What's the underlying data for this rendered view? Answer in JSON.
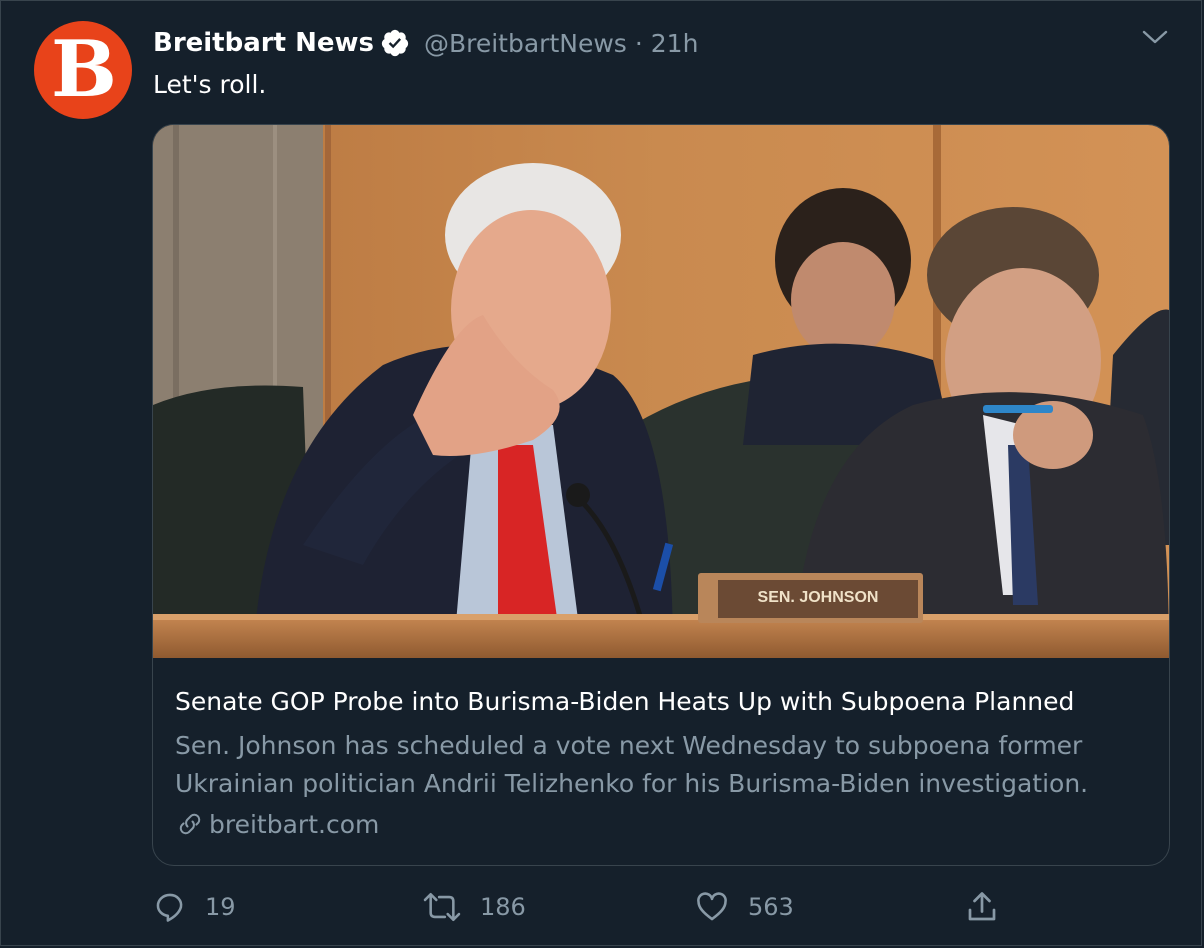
{
  "tweet": {
    "author_name": "Breitbart News",
    "handle": "@BreitbartNews",
    "separator": "·",
    "time": "21h",
    "text": "Let's roll.",
    "avatar_letter": "B"
  },
  "card": {
    "image_placard_text": "SEN. JOHNSON",
    "title": "Senate GOP Probe into Burisma-Biden Heats Up with Subpoena Planned",
    "description_line1": "Sen. Johnson has scheduled a vote next Wednesday to subpoena former",
    "description_line2": "Ukrainian politician Andrii Telizhenko for his Burisma-Biden investigation.",
    "domain": "breitbart.com"
  },
  "actions": {
    "replies": "19",
    "retweets": "186",
    "likes": "563"
  },
  "icons": {
    "verified": "verified-badge-icon",
    "caret": "chevron-down-icon",
    "reply": "reply-icon",
    "retweet": "retweet-icon",
    "like": "heart-icon",
    "share": "share-icon",
    "link": "link-icon"
  },
  "colors": {
    "background": "#15202b",
    "border": "#38444d",
    "secondary_text": "#8899a6",
    "avatar_brand": "#e8431a"
  }
}
